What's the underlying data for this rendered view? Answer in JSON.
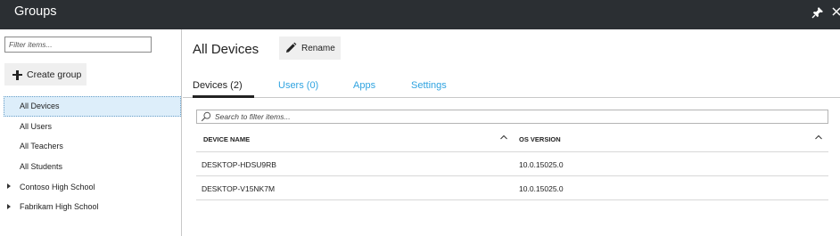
{
  "titlebar": {
    "title": "Groups",
    "pin_icon": "pin-icon",
    "close_icon": "close-icon"
  },
  "left": {
    "filter_placeholder": "Filter items...",
    "create_group_label": "Create group",
    "tree": [
      {
        "label": "All Devices",
        "selected": true,
        "expandable": false
      },
      {
        "label": "All Users",
        "selected": false,
        "expandable": false
      },
      {
        "label": "All Teachers",
        "selected": false,
        "expandable": false
      },
      {
        "label": "All Students",
        "selected": false,
        "expandable": false
      },
      {
        "label": "Contoso High School",
        "selected": false,
        "expandable": true
      },
      {
        "label": "Fabrikam High School",
        "selected": false,
        "expandable": true
      }
    ]
  },
  "main": {
    "title": "All Devices",
    "rename_label": "Rename",
    "tabs": [
      {
        "label": "Devices (2)",
        "active": true
      },
      {
        "label": "Users (0)",
        "active": false
      },
      {
        "label": "Apps",
        "active": false
      },
      {
        "label": "Settings",
        "active": false
      }
    ],
    "search_placeholder": "Search to filter items...",
    "columns": [
      "DEVICE NAME",
      "OS VERSION"
    ],
    "rows": [
      [
        "DESKTOP-HDSU9RB",
        "10.0.15025.0"
      ],
      [
        "DESKTOP-V15NK7M",
        "10.0.15025.0"
      ]
    ]
  },
  "colors": {
    "titlebar_bg": "#2b2f33",
    "accent": "#2fa3e0",
    "selected_bg": "#ddeefa"
  }
}
